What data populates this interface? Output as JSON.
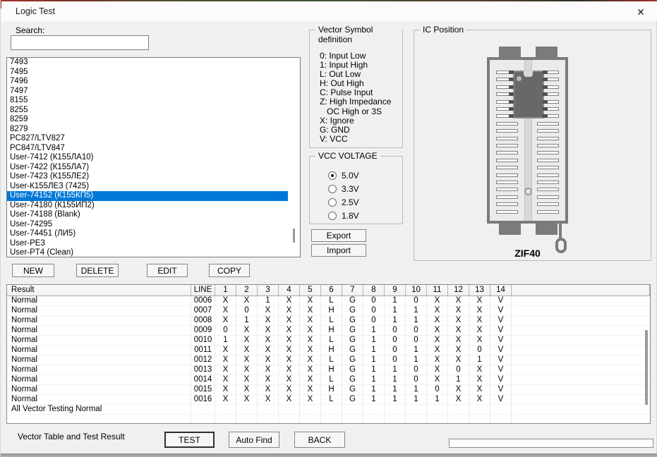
{
  "window": {
    "title": "Logic Test",
    "close_icon": "✕"
  },
  "search": {
    "label": "Search:",
    "value": ""
  },
  "device_list": {
    "items": [
      "7493",
      "7495",
      "7496",
      "7497",
      "8155",
      "8255",
      "8259",
      "8279",
      "PC827/LTV827",
      "PC847/LTV847",
      "User-7412 (К155ЛА10)",
      "User-7422 (К155ЛА7)",
      "User-7423 (К155ЛЕ2)",
      "User-К155ЛЕ3 (7425)",
      "User-74152 (К155КП5)",
      "User-74180 (К155ИП2)",
      "User-74188 (Blank)",
      "User-74295",
      "User-74451 (ЛИ5)",
      "User-PE3",
      "User-PT4 (Clean)"
    ],
    "selected": "User-74152 (К155КП5)"
  },
  "list_buttons": {
    "new": "NEW",
    "delete": "DELETE",
    "edit": "EDIT",
    "copy": "COPY"
  },
  "vector_symbols": {
    "title": "Vector Symbol definition",
    "lines": [
      "0: Input Low",
      "1: Input High",
      "L: Out Low",
      "H: Out High",
      "C: Pulse Input",
      "Z: High Impedance",
      "   OC High or 3S",
      "X: Ignore",
      "G: GND",
      "V: VCC"
    ]
  },
  "vcc_voltage": {
    "title": "VCC VOLTAGE",
    "options": [
      "5.0V",
      "3.3V",
      "2.5V",
      "1.8V"
    ],
    "selected": "5.0V"
  },
  "io_buttons": {
    "export": "Export",
    "import": "Import"
  },
  "ic_position": {
    "title": "IC Position",
    "socket_label": "ZIF40"
  },
  "vector_table": {
    "result_header": "Result",
    "line_header": "LINE",
    "pin_headers": [
      "1",
      "2",
      "3",
      "4",
      "5",
      "6",
      "7",
      "8",
      "9",
      "10",
      "11",
      "12",
      "13",
      "14"
    ],
    "rows": [
      {
        "result": "Normal",
        "line": "0006",
        "pins": [
          "X",
          "X",
          "1",
          "X",
          "X",
          "L",
          "G",
          "0",
          "1",
          "0",
          "X",
          "X",
          "X",
          "V"
        ]
      },
      {
        "result": "Normal",
        "line": "0007",
        "pins": [
          "X",
          "0",
          "X",
          "X",
          "X",
          "H",
          "G",
          "0",
          "1",
          "1",
          "X",
          "X",
          "X",
          "V"
        ]
      },
      {
        "result": "Normal",
        "line": "0008",
        "pins": [
          "X",
          "1",
          "X",
          "X",
          "X",
          "L",
          "G",
          "0",
          "1",
          "1",
          "X",
          "X",
          "X",
          "V"
        ]
      },
      {
        "result": "Normal",
        "line": "0009",
        "pins": [
          "0",
          "X",
          "X",
          "X",
          "X",
          "H",
          "G",
          "1",
          "0",
          "0",
          "X",
          "X",
          "X",
          "V"
        ]
      },
      {
        "result": "Normal",
        "line": "0010",
        "pins": [
          "1",
          "X",
          "X",
          "X",
          "X",
          "L",
          "G",
          "1",
          "0",
          "0",
          "X",
          "X",
          "X",
          "V"
        ]
      },
      {
        "result": "Normal",
        "line": "0011",
        "pins": [
          "X",
          "X",
          "X",
          "X",
          "X",
          "H",
          "G",
          "1",
          "0",
          "1",
          "X",
          "X",
          "0",
          "V"
        ]
      },
      {
        "result": "Normal",
        "line": "0012",
        "pins": [
          "X",
          "X",
          "X",
          "X",
          "X",
          "L",
          "G",
          "1",
          "0",
          "1",
          "X",
          "X",
          "1",
          "V"
        ]
      },
      {
        "result": "Normal",
        "line": "0013",
        "pins": [
          "X",
          "X",
          "X",
          "X",
          "X",
          "H",
          "G",
          "1",
          "1",
          "0",
          "X",
          "0",
          "X",
          "V"
        ]
      },
      {
        "result": "Normal",
        "line": "0014",
        "pins": [
          "X",
          "X",
          "X",
          "X",
          "X",
          "L",
          "G",
          "1",
          "1",
          "0",
          "X",
          "1",
          "X",
          "V"
        ]
      },
      {
        "result": "Normal",
        "line": "0015",
        "pins": [
          "X",
          "X",
          "X",
          "X",
          "X",
          "H",
          "G",
          "1",
          "1",
          "1",
          "0",
          "X",
          "X",
          "V"
        ]
      },
      {
        "result": "Normal",
        "line": "0016",
        "pins": [
          "X",
          "X",
          "X",
          "X",
          "X",
          "L",
          "G",
          "1",
          "1",
          "1",
          "1",
          "X",
          "X",
          "V"
        ]
      }
    ],
    "summary": "All Vector Testing Normal"
  },
  "footer": {
    "label": "Vector Table and Test Result",
    "test": "TEST",
    "auto_find": "Auto Find",
    "back": "BACK"
  },
  "colors": {
    "selection_bg": "#0078d7",
    "selection_text": "#ffffff"
  }
}
